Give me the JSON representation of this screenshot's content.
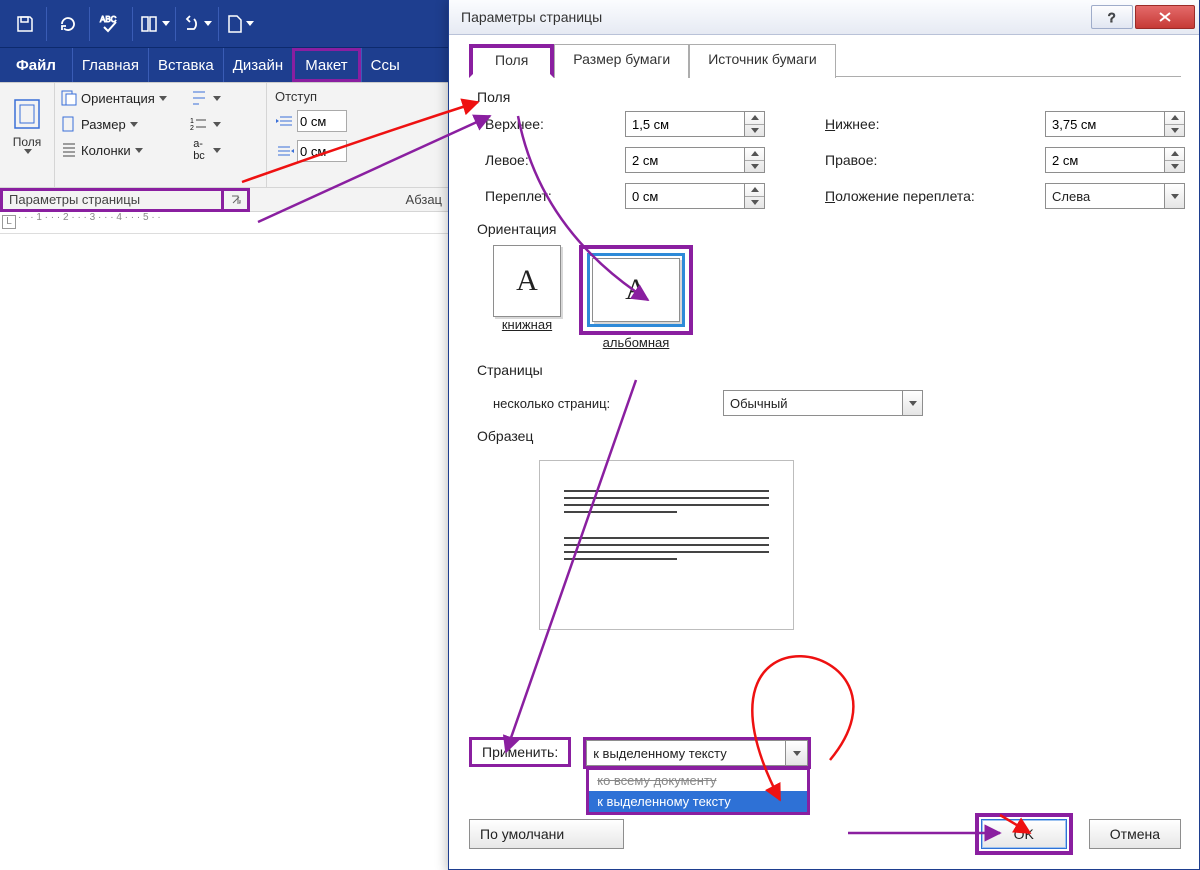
{
  "qat_tooltip": "ABC",
  "menu": {
    "file": "Файл",
    "home": "Главная",
    "insert": "Вставка",
    "design": "Дизайн",
    "layout": "Макет",
    "refs": "Ссы"
  },
  "ribbon": {
    "margins": "Поля",
    "orientation": "Ориентация",
    "size": "Размер",
    "columns": "Колонки",
    "indent_title": "Отступ",
    "indent_value": "0 см",
    "group_para": "Абзац",
    "page_setup": "Параметры страницы"
  },
  "dialog": {
    "title": "Параметры страницы",
    "tabs": {
      "fields": "Поля",
      "paper": "Размер бумаги",
      "source": "Источник бумаги"
    },
    "section_margins": "Поля",
    "top": "Верхнее:",
    "bottom": "Нижнее:",
    "left": "Левое:",
    "right": "Правое:",
    "gutter": "Переплет:",
    "gutter_pos": "Положение переплета:",
    "val_top": "1,5 см",
    "val_bottom": "3,75 см",
    "val_left": "2 см",
    "val_right": "2 см",
    "val_gutter": "0 см",
    "val_gutter_pos": "Слева",
    "section_orient": "Ориентация",
    "portrait": "книжная",
    "landscape": "альбомная",
    "section_pages": "Страницы",
    "pages_label": "несколько страниц:",
    "pages_value": "Обычный",
    "preview": "Образец",
    "apply_label": "Применить:",
    "apply_value": "к выделенному тексту",
    "apply_opt_all": "ко всему документу",
    "apply_opt_sel": "к выделенному тексту",
    "defaults": "По умолчани",
    "ok": "OK",
    "cancel": "Отмена"
  }
}
